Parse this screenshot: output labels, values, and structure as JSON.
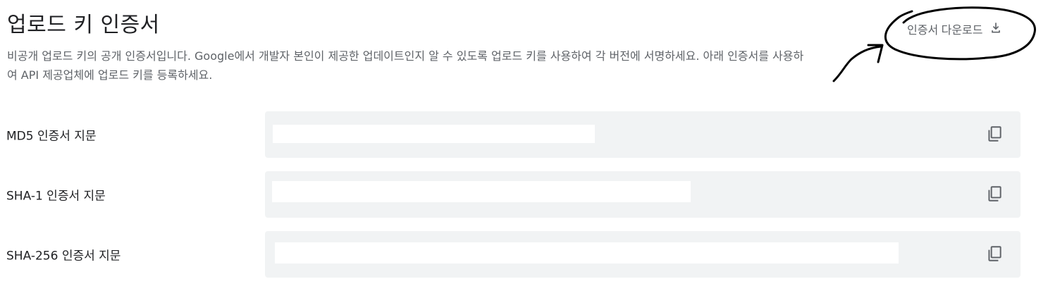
{
  "header": {
    "title": "업로드 키 인증서",
    "description": "비공개 업로드 키의 공개 인증서입니다. Google에서 개발자 본인이 제공한 업데이트인지 알 수 있도록 업로드 키를 사용하여 각 버전에 서명하세요. 아래 인증서를 사용하여 API 제공업체에 업로드 키를 등록하세요.",
    "download_label": "인증서 다운로드",
    "download_icon": "download-icon"
  },
  "fingerprints": [
    {
      "label": "MD5 인증서 지문",
      "value": "",
      "copy_icon": "copy-icon"
    },
    {
      "label": "SHA-1 인증서 지문",
      "value": "",
      "copy_icon": "copy-icon"
    },
    {
      "label": "SHA-256 인증서 지문",
      "value": "",
      "copy_icon": "copy-icon"
    }
  ],
  "colors": {
    "text_primary": "#202124",
    "text_secondary": "#5f6368",
    "field_background": "#f1f3f4",
    "redaction": "#ffffff",
    "annotation_ink": "#000000"
  }
}
